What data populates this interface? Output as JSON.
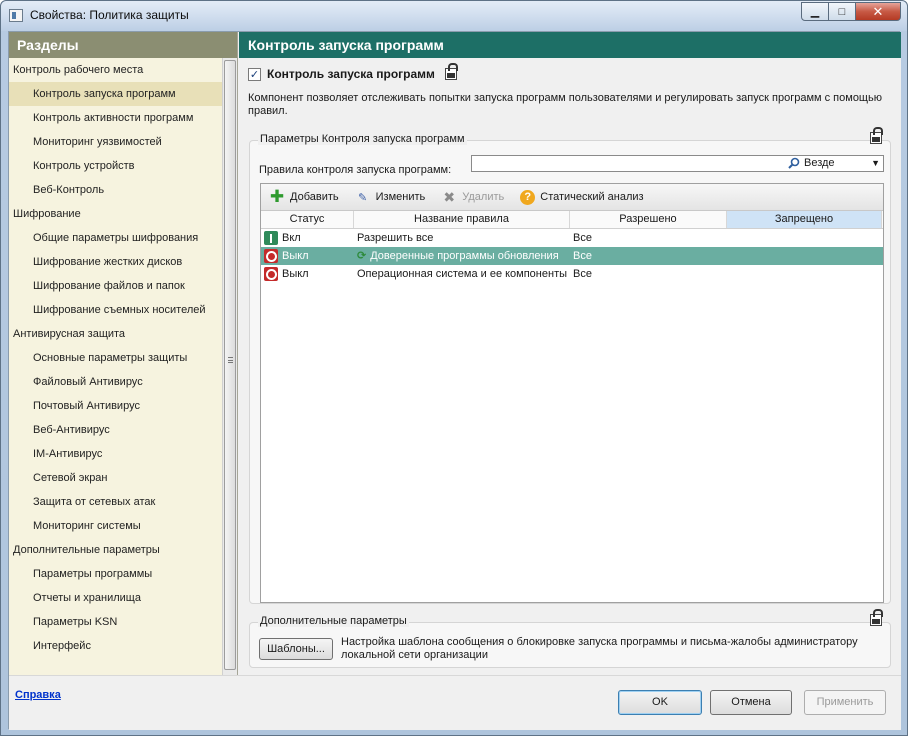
{
  "window": {
    "title": "Свойства: Политика защиты",
    "minimize": "▁",
    "maximize": "□",
    "close": "✕"
  },
  "sidebar": {
    "header": "Разделы",
    "items": [
      {
        "label": "Контроль рабочего места",
        "type": "section"
      },
      {
        "label": "Контроль запуска программ",
        "type": "item",
        "active": true
      },
      {
        "label": "Контроль активности программ",
        "type": "item"
      },
      {
        "label": "Мониторинг уязвимостей",
        "type": "item"
      },
      {
        "label": "Контроль устройств",
        "type": "item"
      },
      {
        "label": "Веб-Контроль",
        "type": "item"
      },
      {
        "label": "Шифрование",
        "type": "section"
      },
      {
        "label": "Общие параметры шифрования",
        "type": "item"
      },
      {
        "label": "Шифрование жестких дисков",
        "type": "item"
      },
      {
        "label": "Шифрование файлов и папок",
        "type": "item"
      },
      {
        "label": "Шифрование съемных носителей",
        "type": "item"
      },
      {
        "label": "Антивирусная защита",
        "type": "section"
      },
      {
        "label": "Основные параметры защиты",
        "type": "item"
      },
      {
        "label": "Файловый Антивирус",
        "type": "item"
      },
      {
        "label": "Почтовый Антивирус",
        "type": "item"
      },
      {
        "label": "Веб-Антивирус",
        "type": "item"
      },
      {
        "label": "IM-Антивирус",
        "type": "item"
      },
      {
        "label": "Сетевой экран",
        "type": "item"
      },
      {
        "label": "Защита от сетевых атак",
        "type": "item"
      },
      {
        "label": "Мониторинг системы",
        "type": "item"
      },
      {
        "label": "Дополнительные параметры",
        "type": "section"
      },
      {
        "label": "Параметры программы",
        "type": "item"
      },
      {
        "label": "Отчеты и хранилища",
        "type": "item"
      },
      {
        "label": "Параметры KSN",
        "type": "item"
      },
      {
        "label": "Интерфейс",
        "type": "item"
      }
    ]
  },
  "main": {
    "header": "Контроль запуска программ",
    "component_checkbox": "✓",
    "component_title": "Контроль запуска программ",
    "description": "Компонент позволяет отслеживать попытки запуска программ пользователями и регулировать запуск программ с помощью правил.",
    "params_group": {
      "legend": "Параметры Контроля запуска программ",
      "rules_label": "Правила контроля запуска программ:",
      "dropdown_value": "Везде"
    },
    "toolbar": {
      "add": "Добавить",
      "edit": "Изменить",
      "delete": "Удалить",
      "analysis": "Статический анализ"
    },
    "table": {
      "columns": [
        "Статус",
        "Название правила",
        "Разрешено",
        "Запрещено"
      ],
      "rows": [
        {
          "status": "Вкл",
          "state": "on",
          "name": "Разрешить все",
          "allowed": "Все",
          "denied": "",
          "selected": false,
          "sync": false
        },
        {
          "status": "Выкл",
          "state": "off",
          "name": "Доверенные программы обновления",
          "allowed": "Все",
          "denied": "",
          "selected": true,
          "sync": true
        },
        {
          "status": "Выкл",
          "state": "off",
          "name": "Операционная система и ее компоненты",
          "allowed": "Все",
          "denied": "",
          "selected": false,
          "sync": false
        }
      ]
    },
    "extra_group": {
      "legend": "Дополнительные параметры",
      "templates_button": "Шаблоны...",
      "description": "Настройка шаблона сообщения о блокировке запуска программы и письма-жалобы администратору локальной сети организации"
    }
  },
  "footer": {
    "help": "Справка",
    "ok": "OK",
    "cancel": "Отмена",
    "apply": "Применить"
  }
}
